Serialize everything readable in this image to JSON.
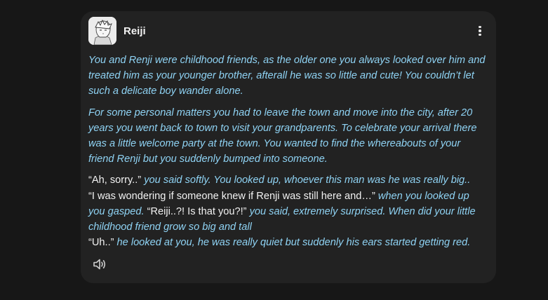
{
  "message": {
    "author": "Reiji",
    "icons": {
      "more": "more-vertical-icon",
      "speaker": "speaker-icon"
    },
    "paragraph1": "You and Renji were childhood friends, as the older one you always looked over him and treated him as your younger brother, afterall he was so little and cute! You couldn’t let such a delicate boy wander alone.",
    "paragraph2": "For some personal matters you had to leave the town and move into the city, after 20 years you went back to town to visit your grandparents. To celebrate your arrival there was a little welcome party at the town. You wanted to find the whereabouts of your friend Renji but you suddenly bumped into someone.",
    "dialogue": {
      "line1_quote": "“Ah, sorry..”",
      "line1_narr": " you said softly. You looked up, whoever this man was he was really big..",
      "line2_quote": "“I was wondering if someone knew if Renji was still here and…”",
      "line2_narr": " when you looked up you gasped. ",
      "line2_quote2": "“Reiji..?! Is that you?!”",
      "line2_narr2": " you said, extremely surprised. When did your little childhood friend grow so big and tall",
      "line3_quote": "“Uh..”",
      "line3_narr": " he looked at you, he was really quiet but suddenly his ears started getting red."
    }
  },
  "colors": {
    "page_background": "#171717",
    "card_background": "#222222",
    "narration_text": "#8fd3f4",
    "speech_text": "#f2f2f2"
  }
}
